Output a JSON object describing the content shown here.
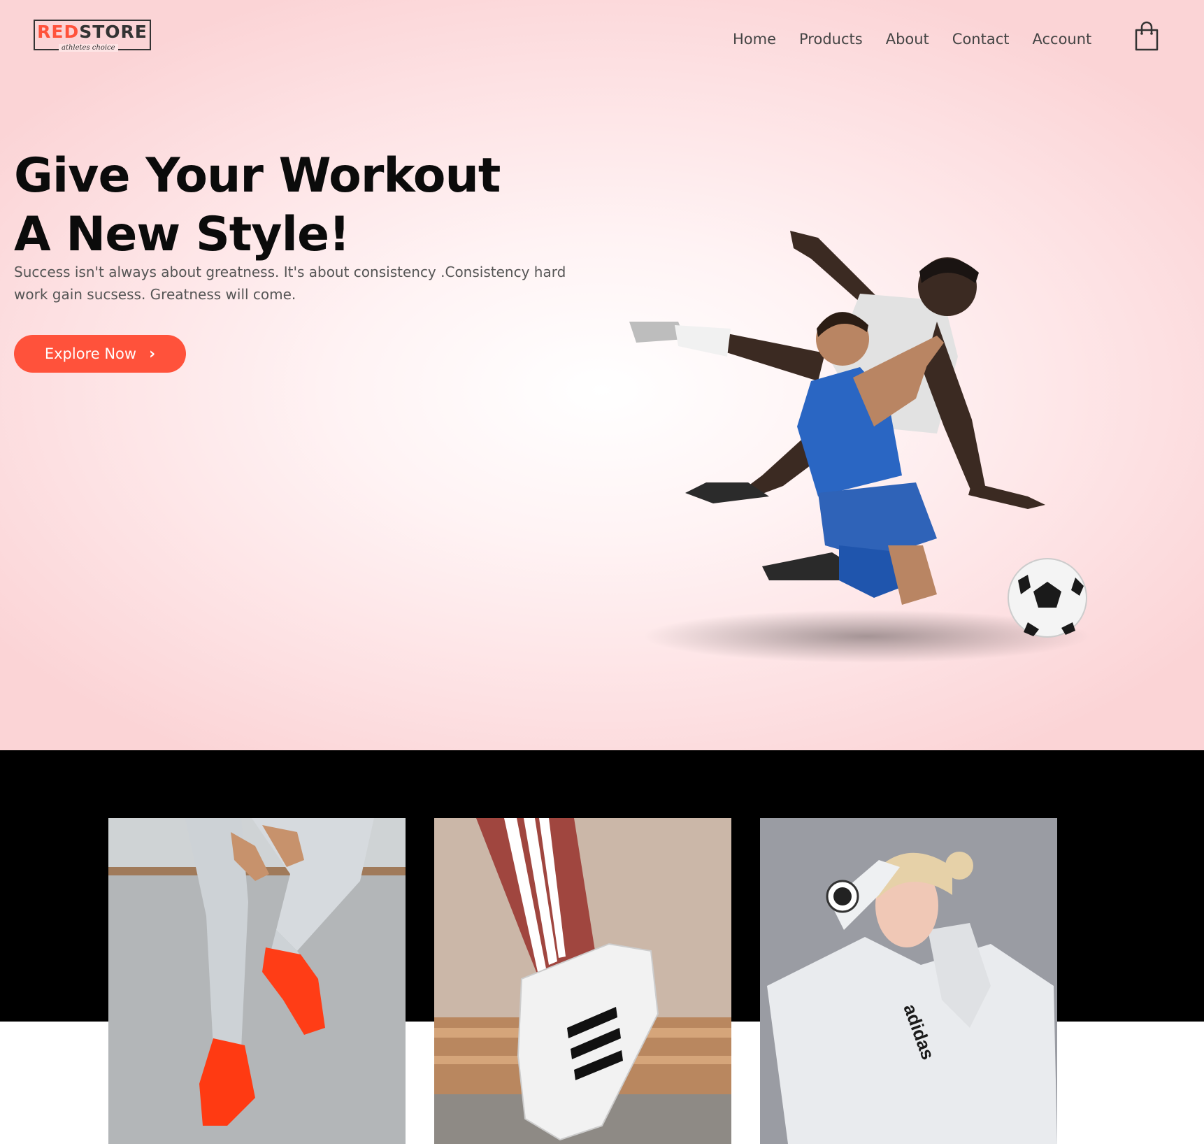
{
  "brand": {
    "logo_part1": "RED",
    "logo_part2": "STORE",
    "tagline": "athletes choice",
    "accent": "#ff523b"
  },
  "nav": {
    "items": [
      {
        "label": "Home"
      },
      {
        "label": "Products"
      },
      {
        "label": "About"
      },
      {
        "label": "Contact"
      },
      {
        "label": "Account"
      }
    ],
    "cart_icon": "shopping-bag-icon"
  },
  "hero": {
    "title_line1": "Give Your Workout",
    "title_line2": "A New Style!",
    "description": "Success isn't always about greatness. It's about consistency .Consistency hard work gain sucsess. Greatness will come.",
    "button_label": "Explore Now",
    "button_icon": "chevron-right-icon",
    "image": "soccer-players-celebrating"
  },
  "categories": [
    {
      "image": "orange-sneakers-jeans"
    },
    {
      "image": "white-striped-sneaker"
    },
    {
      "image": "woman-in-white-hoodie",
      "print": "adidas"
    }
  ]
}
